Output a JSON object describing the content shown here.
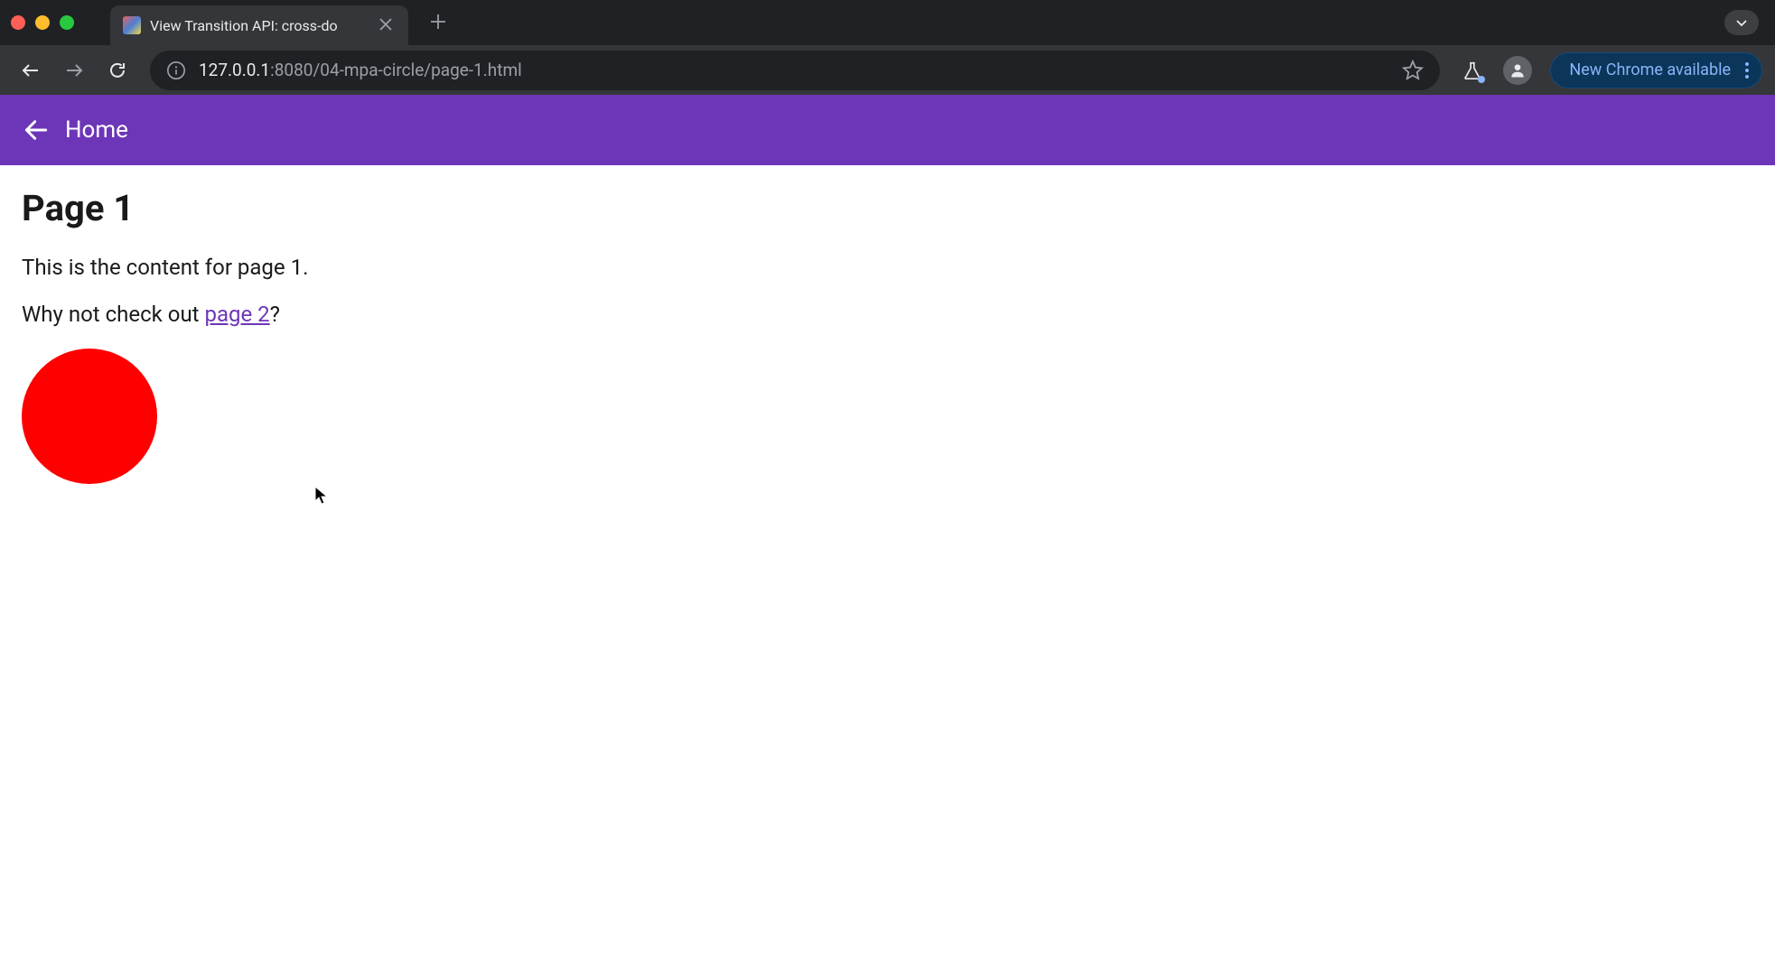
{
  "browser": {
    "tab": {
      "title": "View Transition API: cross-do"
    },
    "url": {
      "host": "127.0.0.1",
      "port": ":8080",
      "path": "/04-mpa-circle/page-1.html"
    },
    "update_label": "New Chrome available"
  },
  "header": {
    "home_label": "Home"
  },
  "content": {
    "title": "Page 1",
    "para1": "This is the content for page 1.",
    "para2_prefix": "Why not check out ",
    "para2_link": "page 2",
    "para2_suffix": "?"
  },
  "colors": {
    "header_bg": "#6d36b8",
    "circle": "#ff0000",
    "link": "#6d36b8"
  }
}
